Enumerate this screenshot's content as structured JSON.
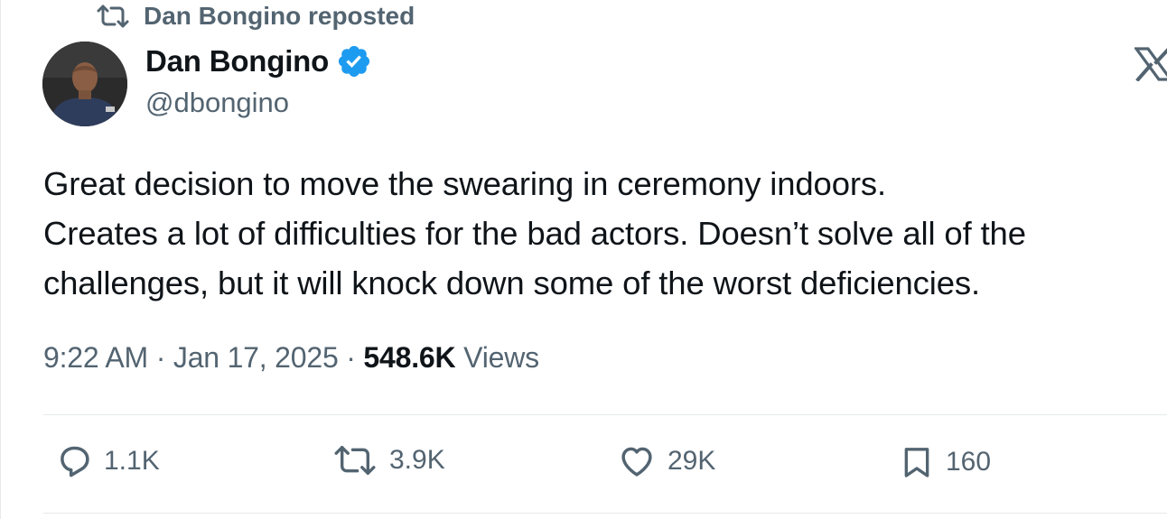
{
  "repost": {
    "label": "Dan Bongino reposted",
    "icon": "retweet-icon"
  },
  "author": {
    "name": "Dan Bongino",
    "handle": "@dbongino",
    "verified": true,
    "verified_color": "#1d9bf0"
  },
  "tweet": {
    "lines": [
      "Great decision to move the swearing in ceremony indoors.",
      "Creates a lot of difficulties for the bad actors. Doesn’t solve all of the",
      "challenges, but it will knock down some of the worst deficiencies."
    ],
    "time": "9:22 AM",
    "separator": "·",
    "date": "Jan 17, 2025",
    "views_count": "548.6K",
    "views_label": "Views"
  },
  "actions": {
    "replies": "1.1K",
    "reposts": "3.9K",
    "likes": "29K",
    "bookmarks": "160"
  },
  "colors": {
    "text": "#0f1419",
    "secondary": "#536471",
    "divider": "#e6e9ec",
    "accent": "#1d9bf0"
  }
}
